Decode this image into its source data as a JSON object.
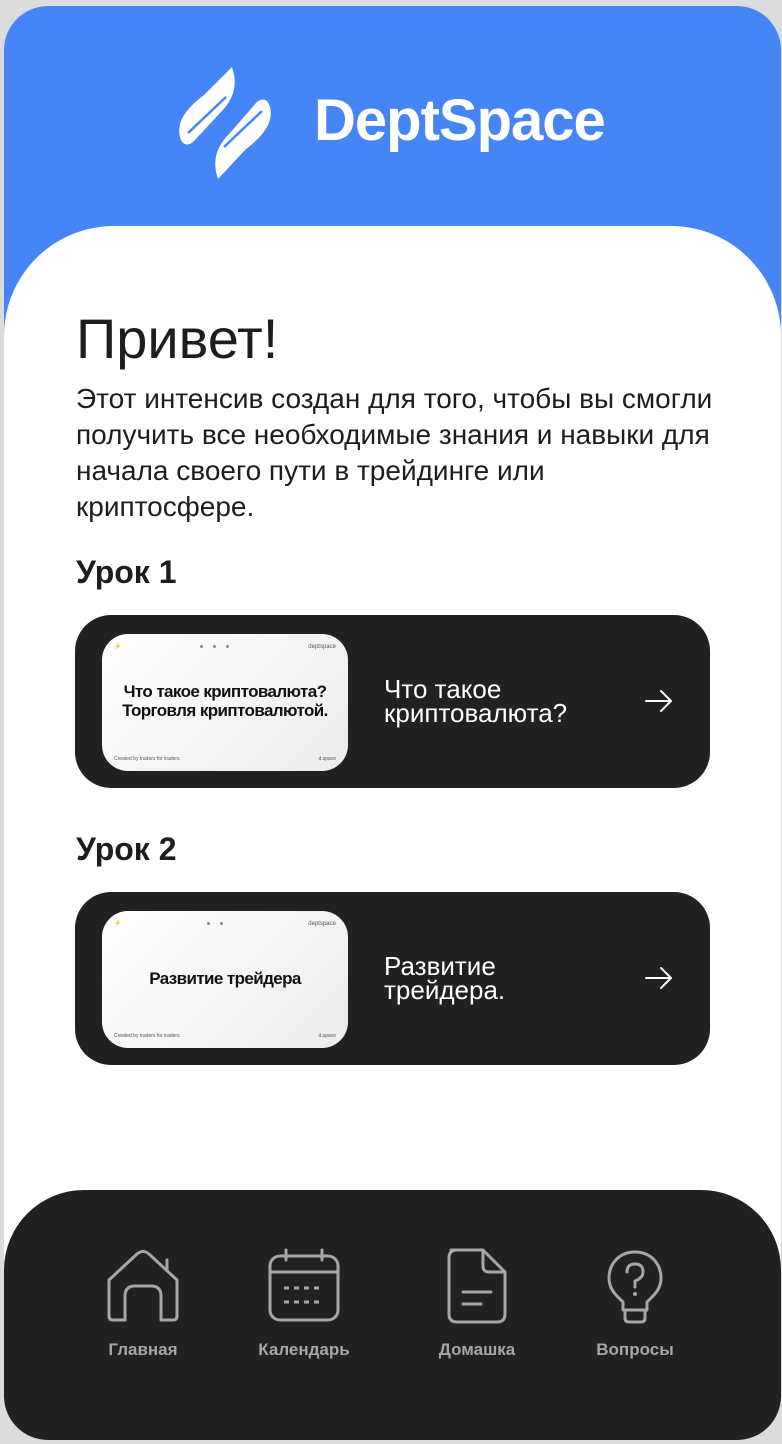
{
  "app": {
    "name": "DeptSpace",
    "brand_color": "#4685f5",
    "dark_color": "#212121"
  },
  "greeting": {
    "title": "Привет!",
    "intro": "Этот интенсив создан для того, чтобы вы смогли получить все необходимые знания и навыки для начала своего пути в трейдинге или криптосфере."
  },
  "lessons": [
    {
      "title": "Урок 1",
      "thumb_title": "Что такое криптовалюта? Торговля криптовалютой.",
      "card_text": "Что такое криптовалюта?",
      "icon": "arrow-right-icon"
    },
    {
      "title": "Урок 2",
      "thumb_title": "Развитие трейдера",
      "card_text": "Развитие трейдера.",
      "icon": "arrow-right-icon"
    }
  ],
  "nav": {
    "items": [
      {
        "label": "Главная",
        "icon": "home-icon"
      },
      {
        "label": "Календарь",
        "icon": "calendar-icon"
      },
      {
        "label": "Домашка",
        "icon": "document-icon"
      },
      {
        "label": "Вопросы",
        "icon": "question-bulb-icon"
      }
    ]
  }
}
